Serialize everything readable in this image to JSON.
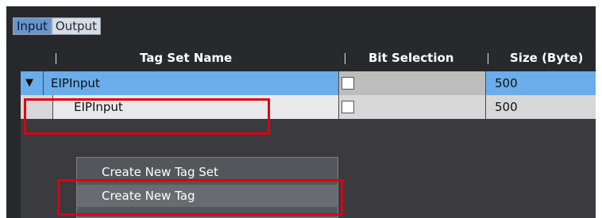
{
  "tabs": [
    {
      "label": "Input",
      "active": true
    },
    {
      "label": "Output",
      "active": false
    }
  ],
  "table": {
    "columns": [
      "Tag Set Name",
      "Bit Selection",
      "Size (Byte)"
    ],
    "rows": [
      {
        "name": "EIPInput",
        "expanded": true,
        "bit_selection": false,
        "size": "500"
      },
      {
        "name": "EIPInput",
        "expanded": false,
        "bit_selection": false,
        "size": "500"
      }
    ]
  },
  "context_menu": {
    "items": [
      {
        "label": "Create New Tag Set"
      },
      {
        "label": "Create New Tag",
        "highlighted": true
      }
    ]
  },
  "colors": {
    "highlight_box": "#e00010",
    "selected_row": "#6aadea",
    "active_tab": "#6a94cc"
  },
  "icons": {
    "expand": "chevron-down-icon"
  }
}
